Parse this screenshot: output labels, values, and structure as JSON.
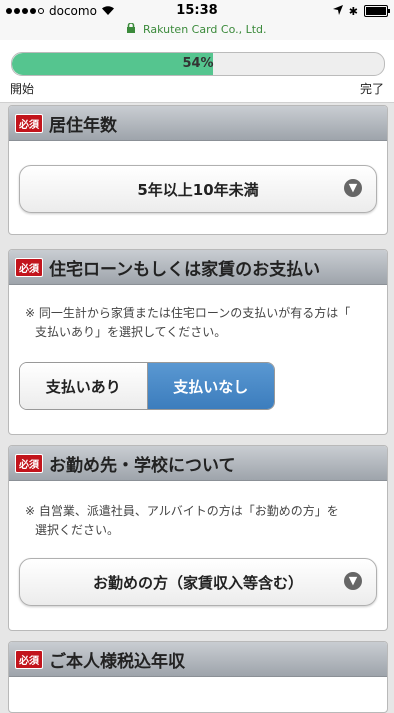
{
  "status_bar": {
    "carrier": "docomo",
    "time": "15:38"
  },
  "url_bar": {
    "site": "Rakuten Card Co., Ltd."
  },
  "progress": {
    "percent_label": "54%",
    "fraction": 0.54,
    "start_label": "開始",
    "end_label": "完了",
    "color": "#55c58f"
  },
  "sections": [
    {
      "badge": "必須",
      "title": "居住年数",
      "select_value": "5年以上10年未満"
    },
    {
      "badge": "必須",
      "title": "住宅ローンもしくは家賃のお支払い",
      "note_line1": "※ 同一生計から家賃または住宅ローンの支払いが有る方は「",
      "note_line2": "支払いあり」を選択してください。",
      "option_yes": "支払いあり",
      "option_no": "支払いなし",
      "selected": "支払いなし"
    },
    {
      "badge": "必須",
      "title": "お勤め先・学校について",
      "note_line1": "※ 自営業、派遣社員、アルバイトの方は「お勤めの方」を",
      "note_line2": "選択ください。",
      "select_value": "お勤めの方（家賃収入等含む）"
    },
    {
      "badge": "必須",
      "title": "ご本人様税込年収"
    }
  ],
  "colors": {
    "badge": "#c2141c",
    "selected_segment": "#3c7dbd"
  }
}
